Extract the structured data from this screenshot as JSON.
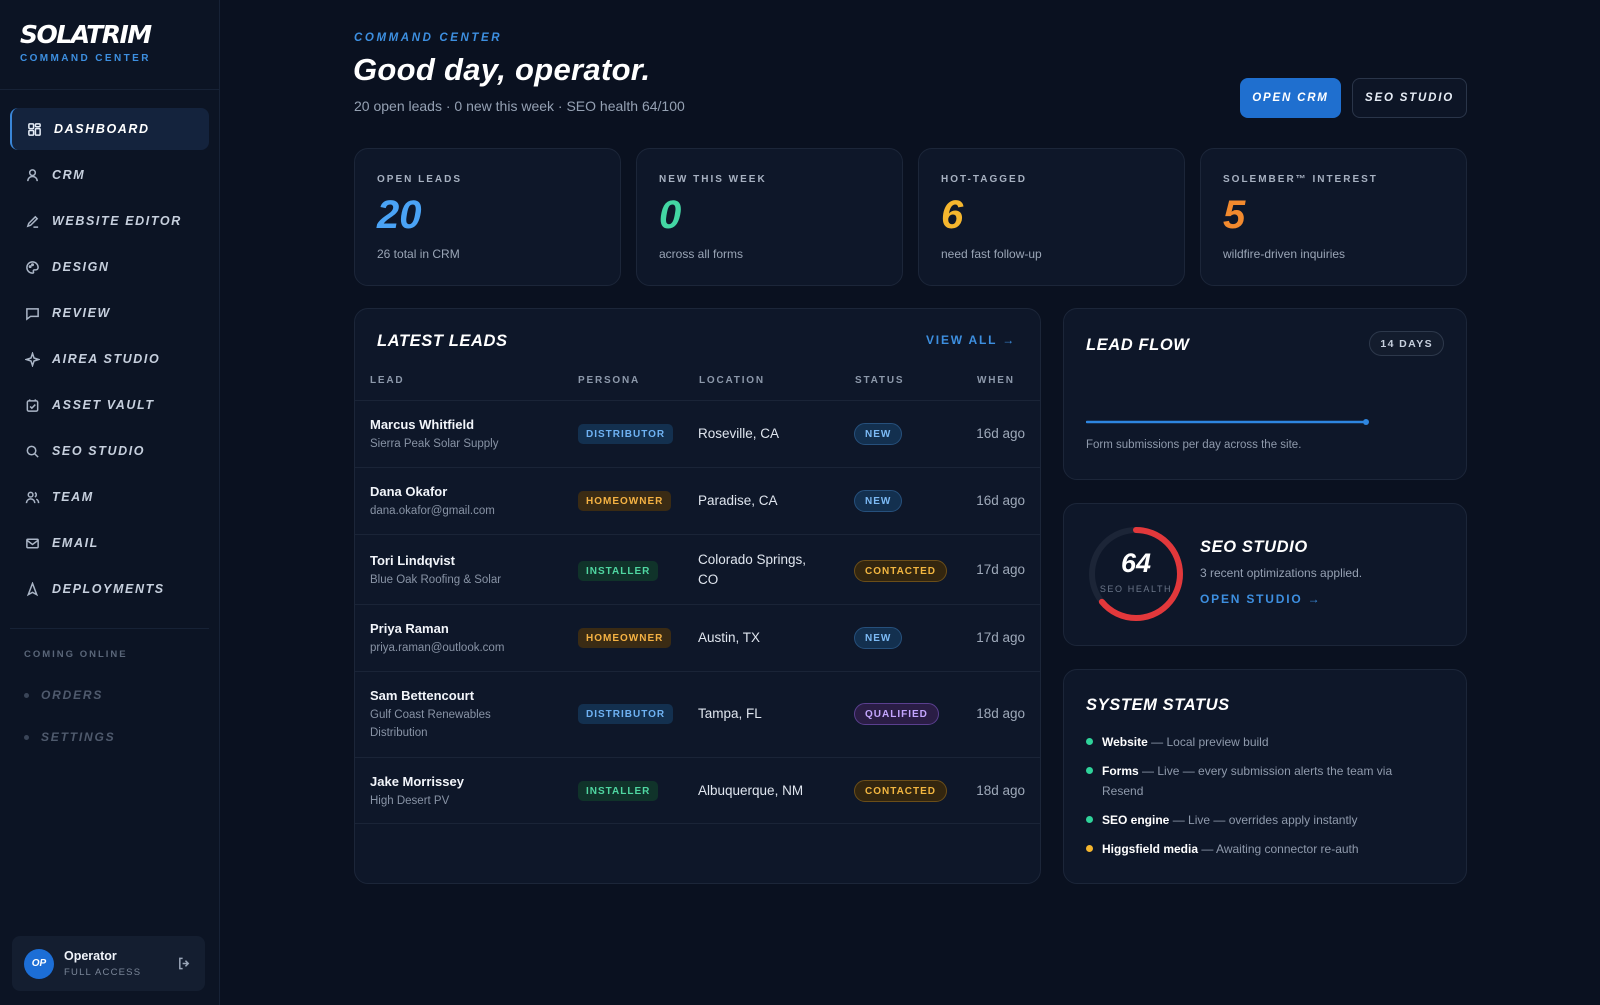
{
  "brand": {
    "logo": "SOLATRIM",
    "subtitle": "COMMAND CENTER"
  },
  "nav": [
    {
      "label": "DASHBOARD",
      "icon": "dashboard-icon",
      "active": true
    },
    {
      "label": "CRM",
      "icon": "user-icon"
    },
    {
      "label": "WEBSITE EDITOR",
      "icon": "pencil-icon"
    },
    {
      "label": "DESIGN",
      "icon": "palette-icon"
    },
    {
      "label": "REVIEW",
      "icon": "chat-icon"
    },
    {
      "label": "AIREA STUDIO",
      "icon": "sparkle-icon"
    },
    {
      "label": "ASSET VAULT",
      "icon": "vault-icon"
    },
    {
      "label": "SEO STUDIO",
      "icon": "search-icon"
    },
    {
      "label": "TEAM",
      "icon": "team-icon"
    },
    {
      "label": "EMAIL",
      "icon": "mail-icon"
    },
    {
      "label": "DEPLOYMENTS",
      "icon": "rocket-icon"
    }
  ],
  "coming_online": {
    "heading": "COMING ONLINE",
    "items": [
      "ORDERS",
      "SETTINGS"
    ]
  },
  "user": {
    "initials": "OP",
    "name": "Operator",
    "role": "FULL ACCESS"
  },
  "header": {
    "eyebrow": "COMMAND CENTER",
    "title": "Good day, operator.",
    "subtitle": "20 open leads · 0 new this week · SEO health 64/100",
    "primary_button": "OPEN CRM",
    "secondary_button": "SEO STUDIO"
  },
  "stats": [
    {
      "label": "OPEN LEADS",
      "value": "20",
      "foot": "26 total in CRM",
      "color": "#4aa3f5"
    },
    {
      "label": "NEW THIS WEEK",
      "value": "0",
      "foot": "across all forms",
      "color": "#43d6a3"
    },
    {
      "label": "HOT-TAGGED",
      "value": "6",
      "foot": "need fast follow-up",
      "color": "#f5b62e"
    },
    {
      "label": "SOLEMBER™ INTEREST",
      "value": "5",
      "foot": "wildfire-driven inquiries",
      "color": "#f28a2e"
    }
  ],
  "leads": {
    "title": "LATEST LEADS",
    "view_all": "VIEW ALL →",
    "columns": [
      "LEAD",
      "PERSONA",
      "LOCATION",
      "STATUS",
      "WHEN"
    ],
    "rows": [
      {
        "name": "Marcus Whitfield",
        "sub": "Sierra Peak Solar Supply",
        "persona": "DISTRIBUTOR",
        "location": "Roseville, CA",
        "status": "NEW",
        "when": "16d ago"
      },
      {
        "name": "Dana Okafor",
        "sub": "dana.okafor@gmail.com",
        "persona": "HOMEOWNER",
        "location": "Paradise, CA",
        "status": "NEW",
        "when": "16d ago"
      },
      {
        "name": "Tori Lindqvist",
        "sub": "Blue Oak Roofing & Solar",
        "persona": "INSTALLER",
        "location": "Colorado Springs, CO",
        "status": "CONTACTED",
        "when": "17d ago"
      },
      {
        "name": "Priya Raman",
        "sub": "priya.raman@outlook.com",
        "persona": "HOMEOWNER",
        "location": "Austin, TX",
        "status": "NEW",
        "when": "17d ago"
      },
      {
        "name": "Sam Bettencourt",
        "sub": "Gulf Coast Renewables Distribution",
        "persona": "DISTRIBUTOR",
        "location": "Tampa, FL",
        "status": "QUALIFIED",
        "when": "18d ago"
      },
      {
        "name": "Jake Morrissey",
        "sub": "High Desert PV",
        "persona": "INSTALLER",
        "location": "Albuquerque, NM",
        "status": "CONTACTED",
        "when": "18d ago"
      }
    ]
  },
  "lead_flow": {
    "title": "LEAD FLOW",
    "range": "14 DAYS",
    "description": "Form submissions per day across the site."
  },
  "seo": {
    "score": "64",
    "score_fraction": 0.64,
    "score_label": "SEO HEALTH",
    "title": "SEO STUDIO",
    "description": "3 recent optimizations applied.",
    "link": "OPEN STUDIO →"
  },
  "system_status": {
    "title": "SYSTEM STATUS",
    "items": [
      {
        "name": "Website",
        "text": " — Local preview build",
        "color": "#2fd39a"
      },
      {
        "name": "Forms",
        "text": " — Live — every submission alerts the team via Resend",
        "color": "#2fd39a"
      },
      {
        "name": "SEO engine",
        "text": " — Live — overrides apply instantly",
        "color": "#2fd39a"
      },
      {
        "name": "Higgsfield media",
        "text": " — Awaiting connector re-auth",
        "color": "#f5b62e"
      }
    ]
  }
}
